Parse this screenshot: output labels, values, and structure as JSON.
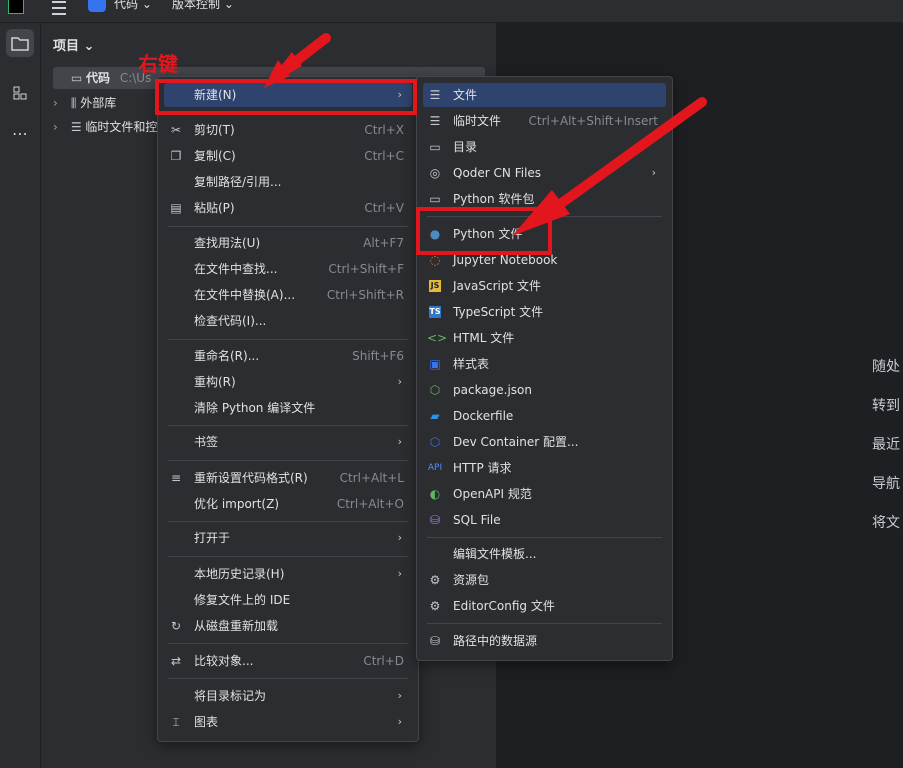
{
  "colors": {
    "highlight": "#2e436e",
    "annotation_red": "#e3161e",
    "accent": "#3574f0"
  },
  "topbar": {
    "project": "代码 ⌄",
    "vcs": "版本控制 ⌄"
  },
  "sidebar": {
    "project_icon": "folder-icon",
    "structure_icon": "structure-icon",
    "more": "⋯"
  },
  "panel": {
    "title": "项目 ⌄",
    "tree": [
      {
        "label": "代码",
        "muted": "C:\\Us",
        "icon": "folder-icon"
      },
      {
        "label": "外部库",
        "icon": "library-icon"
      },
      {
        "label": "临时文件和控",
        "icon": "scratch-icon"
      }
    ]
  },
  "annotation": {
    "label": "右键"
  },
  "context_menu": [
    {
      "label": "新建(N)",
      "shortcut": "",
      "submenu": true,
      "icon": ""
    },
    {
      "label": "剪切(T)",
      "shortcut": "Ctrl+X",
      "icon": "cut-icon"
    },
    {
      "label": "复制(C)",
      "shortcut": "Ctrl+C",
      "icon": "copy-icon"
    },
    {
      "label": "复制路径/引用...",
      "shortcut": "",
      "icon": ""
    },
    {
      "label": "粘贴(P)",
      "shortcut": "Ctrl+V",
      "icon": "paste-icon"
    },
    {
      "label": "查找用法(U)",
      "shortcut": "Alt+F7",
      "icon": ""
    },
    {
      "label": "在文件中查找...",
      "shortcut": "Ctrl+Shift+F",
      "icon": ""
    },
    {
      "label": "在文件中替换(A)...",
      "shortcut": "Ctrl+Shift+R",
      "icon": ""
    },
    {
      "label": "检查代码(I)...",
      "shortcut": "",
      "icon": ""
    },
    {
      "label": "重命名(R)...",
      "shortcut": "Shift+F6",
      "icon": ""
    },
    {
      "label": "重构(R)",
      "shortcut": "",
      "submenu": true,
      "icon": ""
    },
    {
      "label": "清除 Python 编译文件",
      "shortcut": "",
      "icon": ""
    },
    {
      "label": "书签",
      "shortcut": "",
      "submenu": true,
      "icon": ""
    },
    {
      "label": "重新设置代码格式(R)",
      "shortcut": "Ctrl+Alt+L",
      "icon": "format-icon"
    },
    {
      "label": "优化 import(Z)",
      "shortcut": "Ctrl+Alt+O",
      "icon": ""
    },
    {
      "label": "打开于",
      "shortcut": "",
      "submenu": true,
      "icon": ""
    },
    {
      "label": "本地历史记录(H)",
      "shortcut": "",
      "submenu": true,
      "icon": ""
    },
    {
      "label": "修复文件上的 IDE",
      "shortcut": "",
      "icon": ""
    },
    {
      "label": "从磁盘重新加载",
      "shortcut": "",
      "icon": "reload-icon"
    },
    {
      "label": "比较对象...",
      "shortcut": "Ctrl+D",
      "icon": "compare-icon"
    },
    {
      "label": "将目录标记为",
      "shortcut": "",
      "submenu": true,
      "icon": ""
    },
    {
      "label": "图表",
      "shortcut": "",
      "submenu": true,
      "icon": "diagram-icon"
    }
  ],
  "new_submenu": [
    {
      "label": "文件",
      "shortcut": "",
      "icon": "file-icon"
    },
    {
      "label": "临时文件",
      "shortcut": "Ctrl+Alt+Shift+Insert",
      "icon": "scratch-file-icon"
    },
    {
      "label": "目录",
      "shortcut": "",
      "icon": "folder-icon"
    },
    {
      "label": "Qoder CN Files",
      "shortcut": "",
      "submenu": true,
      "icon": "qoder-icon"
    },
    {
      "label": "Python 软件包",
      "shortcut": "",
      "icon": "python-package-icon"
    },
    {
      "label": "Python 文件",
      "shortcut": "",
      "icon": "python-icon"
    },
    {
      "label": "Jupyter Notebook",
      "shortcut": "",
      "icon": "jupyter-icon"
    },
    {
      "label": "JavaScript 文件",
      "shortcut": "",
      "icon": "js-icon"
    },
    {
      "label": "TypeScript 文件",
      "shortcut": "",
      "icon": "ts-icon"
    },
    {
      "label": "HTML 文件",
      "shortcut": "",
      "icon": "html-icon"
    },
    {
      "label": "样式表",
      "shortcut": "",
      "icon": "css-icon"
    },
    {
      "label": "package.json",
      "shortcut": "",
      "icon": "nodejs-icon"
    },
    {
      "label": "Dockerfile",
      "shortcut": "",
      "icon": "docker-icon"
    },
    {
      "label": "Dev Container 配置...",
      "shortcut": "",
      "icon": "devcontainer-icon"
    },
    {
      "label": "HTTP 请求",
      "shortcut": "",
      "icon": "api-icon"
    },
    {
      "label": "OpenAPI 规范",
      "shortcut": "",
      "icon": "openapi-icon"
    },
    {
      "label": "SQL File",
      "shortcut": "",
      "icon": "database-icon"
    },
    {
      "label": "编辑文件模板...",
      "shortcut": "",
      "icon": ""
    },
    {
      "label": "资源包",
      "shortcut": "",
      "icon": "resource-bundle-icon"
    },
    {
      "label": "EditorConfig 文件",
      "shortcut": "",
      "icon": "gear-icon"
    },
    {
      "label": "路径中的数据源",
      "shortcut": "",
      "icon": "database-icon"
    }
  ],
  "editor_hints": [
    "随处",
    "转到",
    "最近",
    "导航",
    "将文"
  ]
}
